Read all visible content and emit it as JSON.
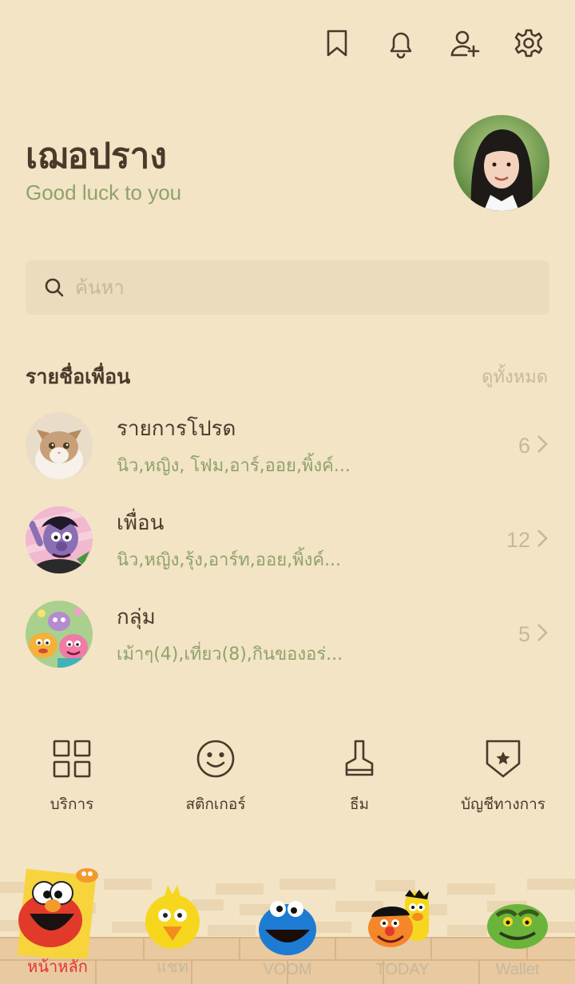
{
  "header": {
    "icons": [
      "bookmark-icon",
      "bell-icon",
      "add-friend-icon",
      "gear-icon"
    ]
  },
  "profile": {
    "name": "เฌอปราง",
    "status": "Good luck to you"
  },
  "search": {
    "placeholder": "ค้นหา"
  },
  "friends_section": {
    "title": "รายชื่อเพื่อน",
    "view_all": "ดูทั้งหมด",
    "rows": [
      {
        "title": "รายการโปรด",
        "subtitle": "นิว,หญิง, โฟม,อาร์,ออย,พิ้งค์...",
        "count": "6"
      },
      {
        "title": "เพื่อน",
        "subtitle": "นิว,หญิง,รุ้ง,อาร์ท,ออย,พิ้งค์...",
        "count": "12"
      },
      {
        "title": "กลุ่ม",
        "subtitle": "เม้าๆ(4),เที่ยว(8),กินของอร่...",
        "count": "5"
      }
    ]
  },
  "services": [
    {
      "label": "บริการ",
      "icon": "grid-icon"
    },
    {
      "label": "สติกเกอร์",
      "icon": "smiley-icon"
    },
    {
      "label": "ธีม",
      "icon": "brush-icon"
    },
    {
      "label": "บัญชีทางการ",
      "icon": "official-shield-icon"
    }
  ],
  "bottom_nav": [
    {
      "label": "หน้าหลัก",
      "active": true
    },
    {
      "label": "แชท",
      "active": false
    },
    {
      "label": "VOOM",
      "active": false
    },
    {
      "label": "TODAY",
      "active": false
    },
    {
      "label": "Wallet",
      "active": false
    }
  ],
  "colors": {
    "background": "#f3e4c6",
    "text": "#4a3a2a",
    "accent_green": "#8fa26a",
    "muted": "#c7b89a",
    "active_tab": "#e8322b"
  }
}
